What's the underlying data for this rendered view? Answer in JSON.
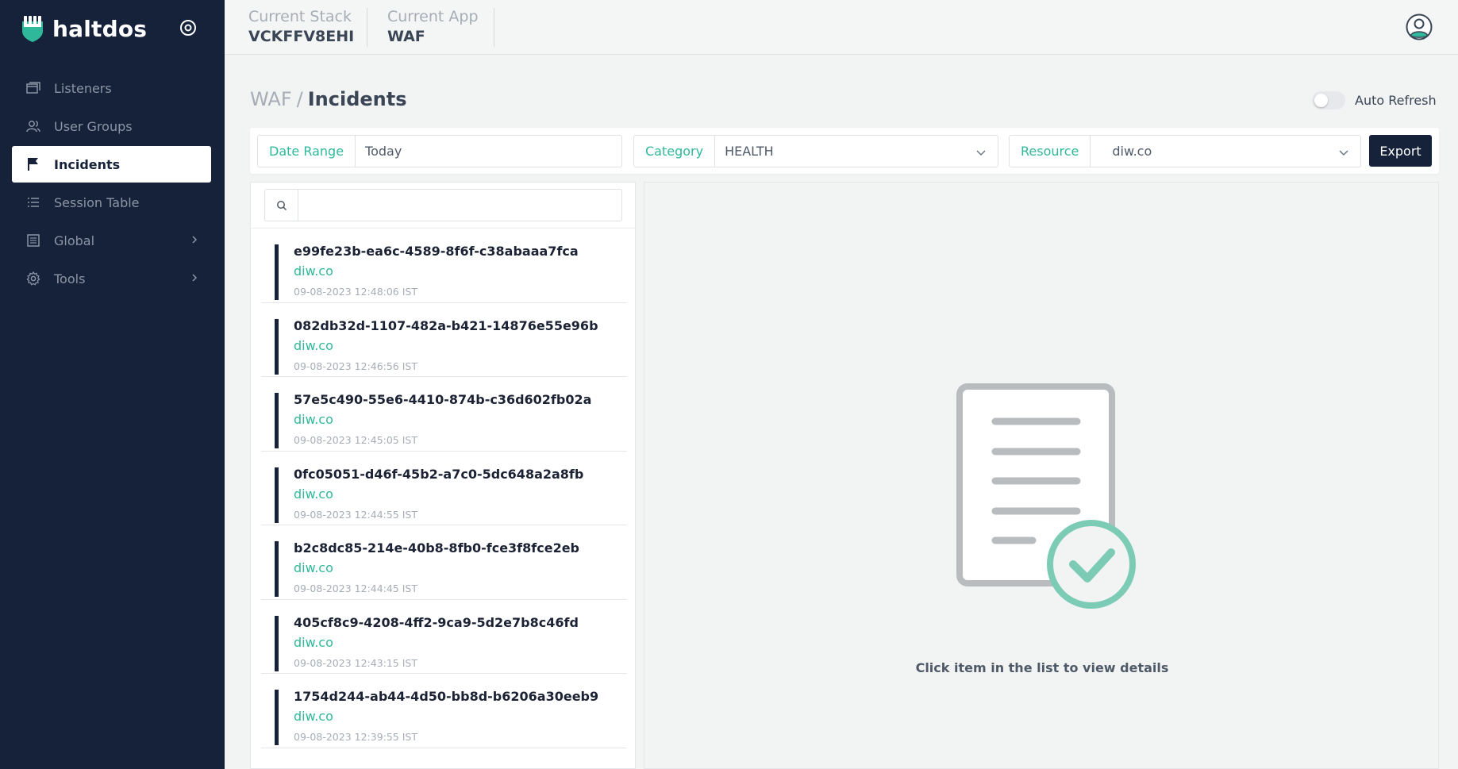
{
  "brand": {
    "name": "haltdos"
  },
  "sidebar": {
    "items": [
      {
        "label": "Listeners",
        "icon": "window-icon",
        "active": false,
        "has_children": false
      },
      {
        "label": "User Groups",
        "icon": "users-icon",
        "active": false,
        "has_children": false
      },
      {
        "label": "Incidents",
        "icon": "flag-icon",
        "active": true,
        "has_children": false
      },
      {
        "label": "Session Table",
        "icon": "list-icon",
        "active": false,
        "has_children": false
      },
      {
        "label": "Global",
        "icon": "table-icon",
        "active": false,
        "has_children": true
      },
      {
        "label": "Tools",
        "icon": "gear-icon",
        "active": false,
        "has_children": true
      }
    ]
  },
  "header": {
    "stack_label": "Current Stack",
    "stack_value": "VCKFFV8EHI",
    "app_label": "Current App",
    "app_value": "WAF"
  },
  "breadcrumb": {
    "parent": "WAF",
    "separator": "/",
    "current": "Incidents"
  },
  "auto_refresh": {
    "label": "Auto Refresh",
    "enabled": false
  },
  "filters": {
    "date_range_label": "Date Range",
    "date_range_value": "Today",
    "category_label": "Category",
    "category_value": "HEALTH",
    "resource_label": "Resource",
    "resource_value": "diw.co",
    "export_label": "Export"
  },
  "search": {
    "placeholder": ""
  },
  "incidents": [
    {
      "id": "e99fe23b-ea6c-4589-8f6f-c38abaaa7fca",
      "resource": "diw.co",
      "time": "09-08-2023 12:48:06 IST"
    },
    {
      "id": "082db32d-1107-482a-b421-14876e55e96b",
      "resource": "diw.co",
      "time": "09-08-2023 12:46:56 IST"
    },
    {
      "id": "57e5c490-55e6-4410-874b-c36d602fb02a",
      "resource": "diw.co",
      "time": "09-08-2023 12:45:05 IST"
    },
    {
      "id": "0fc05051-d46f-45b2-a7c0-5dc648a2a8fb",
      "resource": "diw.co",
      "time": "09-08-2023 12:44:55 IST"
    },
    {
      "id": "b2c8dc85-214e-40b8-8fb0-fce3f8fce2eb",
      "resource": "diw.co",
      "time": "09-08-2023 12:44:45 IST"
    },
    {
      "id": "405cf8c9-4208-4ff2-9ca9-5d2e7b8c46fd",
      "resource": "diw.co",
      "time": "09-08-2023 12:43:15 IST"
    },
    {
      "id": "1754d244-ab44-4d50-bb8d-b6206a30eeb9",
      "resource": "diw.co",
      "time": "09-08-2023 12:39:55 IST"
    }
  ],
  "detail": {
    "empty_message": "Click item in the list to view details"
  },
  "colors": {
    "sidebar_bg": "#16223a",
    "accent": "#2fb89a",
    "page_bg": "#f2f3f3"
  }
}
